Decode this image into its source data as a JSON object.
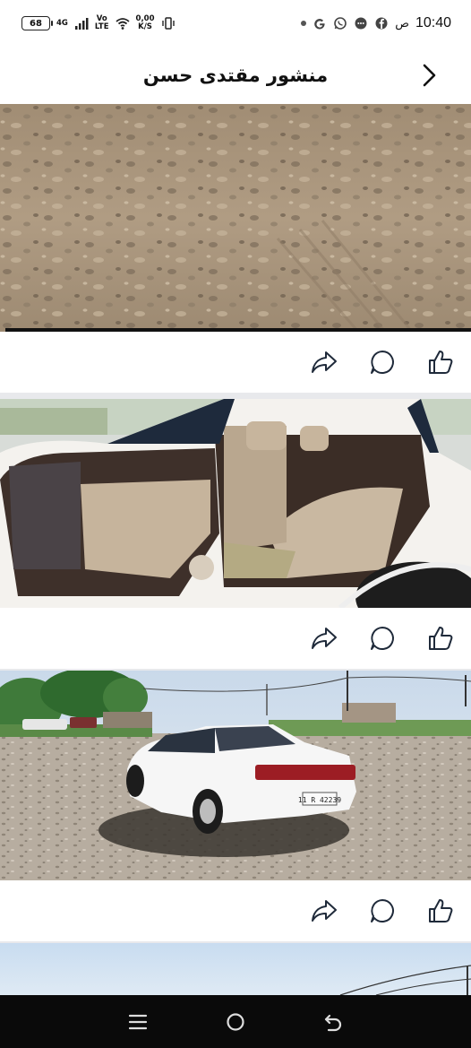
{
  "status_bar": {
    "battery_level": "68",
    "network_type": "4G",
    "volte_top": "Vo",
    "volte_bottom": "LTE",
    "speed_value": "0,00",
    "speed_unit": "K/S",
    "time": "10:40",
    "ampm": "ص"
  },
  "header": {
    "title": "منشور مقتدى حسن",
    "back_icon": "chevron-right-icon"
  },
  "posts": [
    {
      "image": "gravel-ground-photo",
      "actions": [
        "share-icon",
        "comment-icon",
        "like-icon"
      ]
    },
    {
      "image": "car-interior-rear-seat-photo",
      "actions": [
        "share-icon",
        "comment-icon",
        "like-icon"
      ]
    },
    {
      "image": "white-sedan-on-gravel-lot-photo",
      "plate_text": "11 R 42239",
      "actions": [
        "share-icon",
        "comment-icon",
        "like-icon"
      ]
    },
    {
      "image": "sky-power-lines-photo"
    }
  ],
  "nav": {
    "recents": "menu-lines-icon",
    "home": "home-circle-icon",
    "back": "back-arrow-icon"
  },
  "colors": {
    "divider": "#e8e9ec",
    "icon": "#1f2a3a",
    "nav_bg": "#0a0a0a"
  }
}
